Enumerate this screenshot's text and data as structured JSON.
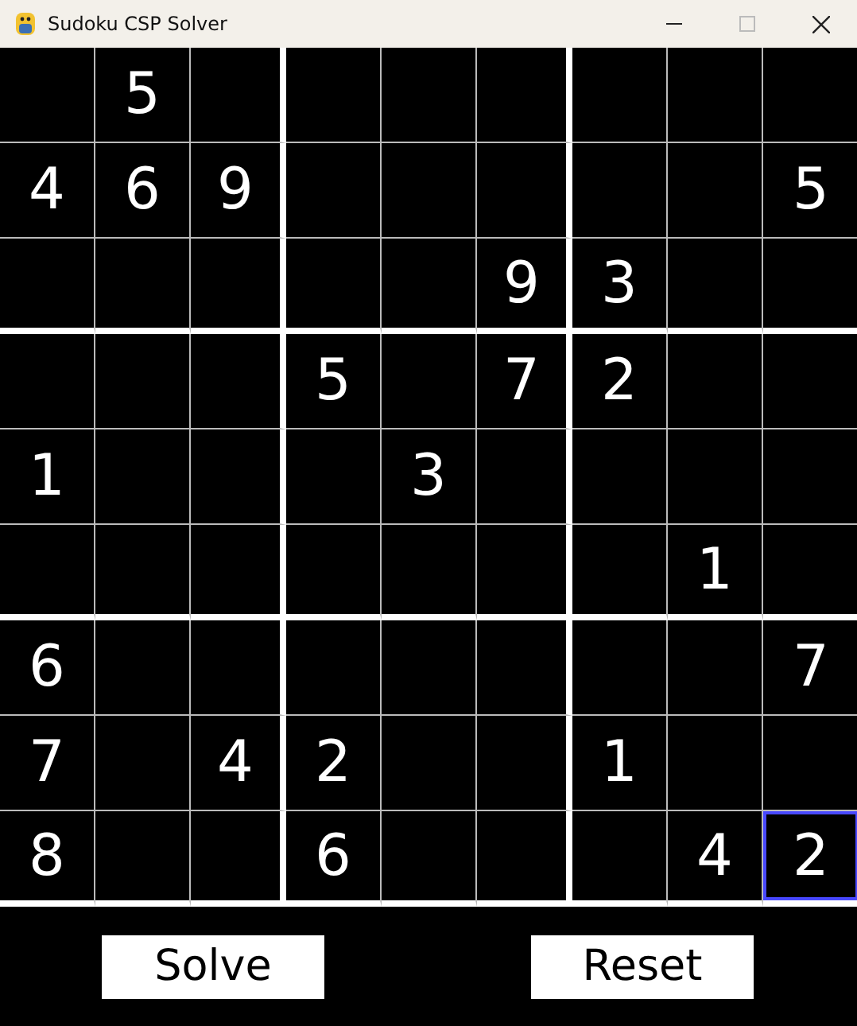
{
  "window": {
    "title": "Sudoku CSP Solver"
  },
  "grid": {
    "rows": [
      [
        {
          "selected": false
        },
        {
          "value": "5",
          "selected": false
        },
        {
          "selected": false
        },
        {
          "selected": false
        },
        {
          "selected": false
        },
        {
          "selected": false
        },
        {
          "selected": false
        },
        {
          "selected": false
        },
        {
          "selected": false
        }
      ],
      [
        {
          "value": "4",
          "selected": false
        },
        {
          "value": "6",
          "selected": false
        },
        {
          "value": "9",
          "selected": false
        },
        {
          "selected": false
        },
        {
          "selected": false
        },
        {
          "selected": false
        },
        {
          "selected": false
        },
        {
          "selected": false
        },
        {
          "value": "5",
          "selected": false
        }
      ],
      [
        {
          "selected": false
        },
        {
          "selected": false
        },
        {
          "selected": false
        },
        {
          "selected": false
        },
        {
          "selected": false
        },
        {
          "value": "9",
          "selected": false
        },
        {
          "value": "3",
          "selected": false
        },
        {
          "selected": false
        },
        {
          "selected": false
        }
      ],
      [
        {
          "selected": false
        },
        {
          "selected": false
        },
        {
          "selected": false
        },
        {
          "value": "5",
          "selected": false
        },
        {
          "selected": false
        },
        {
          "value": "7",
          "selected": false
        },
        {
          "value": "2",
          "selected": false
        },
        {
          "selected": false
        },
        {
          "selected": false
        }
      ],
      [
        {
          "value": "1",
          "selected": false
        },
        {
          "selected": false
        },
        {
          "selected": false
        },
        {
          "selected": false
        },
        {
          "value": "3",
          "selected": false
        },
        {
          "selected": false
        },
        {
          "selected": false
        },
        {
          "selected": false
        },
        {
          "selected": false
        }
      ],
      [
        {
          "selected": false
        },
        {
          "selected": false
        },
        {
          "selected": false
        },
        {
          "selected": false
        },
        {
          "selected": false
        },
        {
          "selected": false
        },
        {
          "selected": false
        },
        {
          "value": "1",
          "selected": false
        },
        {
          "selected": false
        }
      ],
      [
        {
          "value": "6",
          "selected": false
        },
        {
          "selected": false
        },
        {
          "selected": false
        },
        {
          "selected": false
        },
        {
          "selected": false
        },
        {
          "selected": false
        },
        {
          "selected": false
        },
        {
          "selected": false
        },
        {
          "value": "7",
          "selected": false
        }
      ],
      [
        {
          "value": "7",
          "selected": false
        },
        {
          "selected": false
        },
        {
          "value": "4",
          "selected": false
        },
        {
          "value": "2",
          "selected": false
        },
        {
          "selected": false
        },
        {
          "selected": false
        },
        {
          "value": "1",
          "selected": false
        },
        {
          "selected": false
        },
        {
          "selected": false
        }
      ],
      [
        {
          "value": "8",
          "selected": false
        },
        {
          "selected": false
        },
        {
          "selected": false
        },
        {
          "value": "6",
          "selected": false
        },
        {
          "selected": false
        },
        {
          "selected": false
        },
        {
          "selected": false
        },
        {
          "value": "4",
          "selected": false
        },
        {
          "value": "2",
          "selected": true
        }
      ]
    ]
  },
  "buttons": [
    {
      "label": "Solve"
    },
    {
      "label": "Reset"
    }
  ]
}
